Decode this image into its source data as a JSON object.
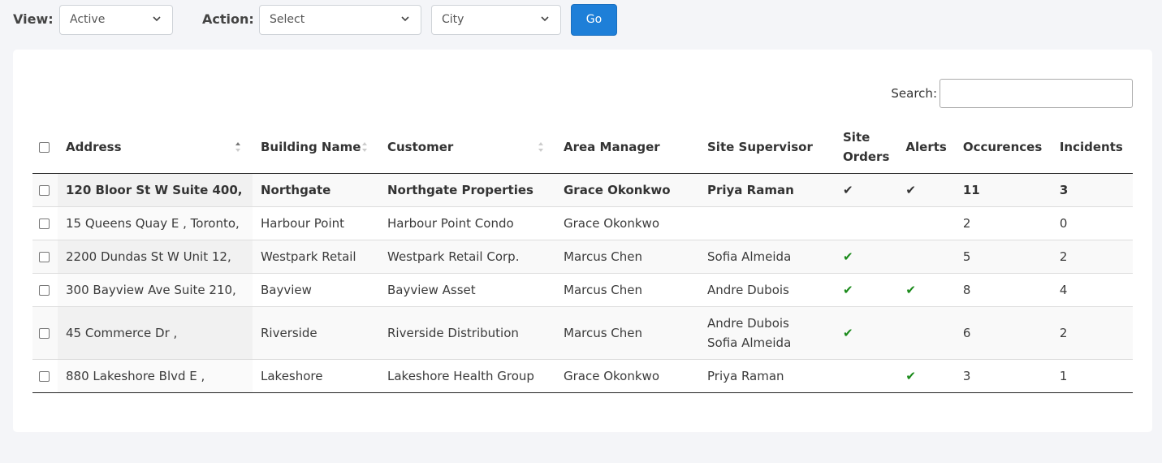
{
  "toolbar": {
    "view_label": "View:",
    "view_value": "Active",
    "action_label": "Action:",
    "action_value": "Select",
    "city_value": "City",
    "go_label": "Go"
  },
  "search": {
    "label": "Search:",
    "value": ""
  },
  "table": {
    "headers": {
      "address": "Address",
      "building_name": "Building Name",
      "customer": "Customer",
      "area_manager": "Area Manager",
      "site_supervisor": "Site Supervisor",
      "site_orders": "Site Orders",
      "alerts": "Alerts",
      "occurences": "Occurences",
      "incidents": "Incidents"
    },
    "rows": [
      {
        "address": "120 Bloor St W Suite 400,",
        "building": "Northgate",
        "customer": "Northgate Properties",
        "manager": "Grace Okonkwo",
        "supervisor": "Priya Raman",
        "site_orders": "✔",
        "alerts": "✔",
        "occurences": "11",
        "incidents": "3"
      },
      {
        "address": "15 Queens Quay E , Toronto,",
        "building": "Harbour Point",
        "customer": "Harbour Point Condo",
        "manager": "Grace Okonkwo",
        "supervisor": "",
        "site_orders": "",
        "alerts": "",
        "occurences": "2",
        "incidents": "0"
      },
      {
        "address": "2200 Dundas St W Unit 12,",
        "building": "Westpark Retail",
        "customer": "Westpark Retail Corp.",
        "manager": "Marcus Chen",
        "supervisor": "Sofia Almeida",
        "site_orders": "✔",
        "alerts": "",
        "occurences": "5",
        "incidents": "2"
      },
      {
        "address": "300 Bayview Ave Suite 210,",
        "building": "Bayview",
        "customer": "Bayview Asset",
        "manager": "Marcus Chen",
        "supervisor": "Andre Dubois",
        "site_orders": "✔",
        "alerts": "✔",
        "occurences": "8",
        "incidents": "4"
      },
      {
        "address": "45 Commerce Dr ,",
        "building": "Riverside",
        "customer": "Riverside Distribution",
        "manager": "Marcus Chen",
        "supervisor": "Andre Dubois",
        "supervisor2": "Sofia Almeida",
        "site_orders": "✔",
        "alerts": "",
        "occurences": "6",
        "incidents": "2"
      },
      {
        "address": "880 Lakeshore Blvd E ,",
        "building": "Lakeshore",
        "customer": "Lakeshore Health Group",
        "manager": "Grace Okonkwo",
        "supervisor": "Priya Raman",
        "site_orders": "",
        "alerts": "✔",
        "occurences": "3",
        "incidents": "1"
      }
    ]
  },
  "colors": {
    "accent": "#1e7fd8",
    "check": "#1a8a1a",
    "page_bg": "#f4f5f8"
  }
}
